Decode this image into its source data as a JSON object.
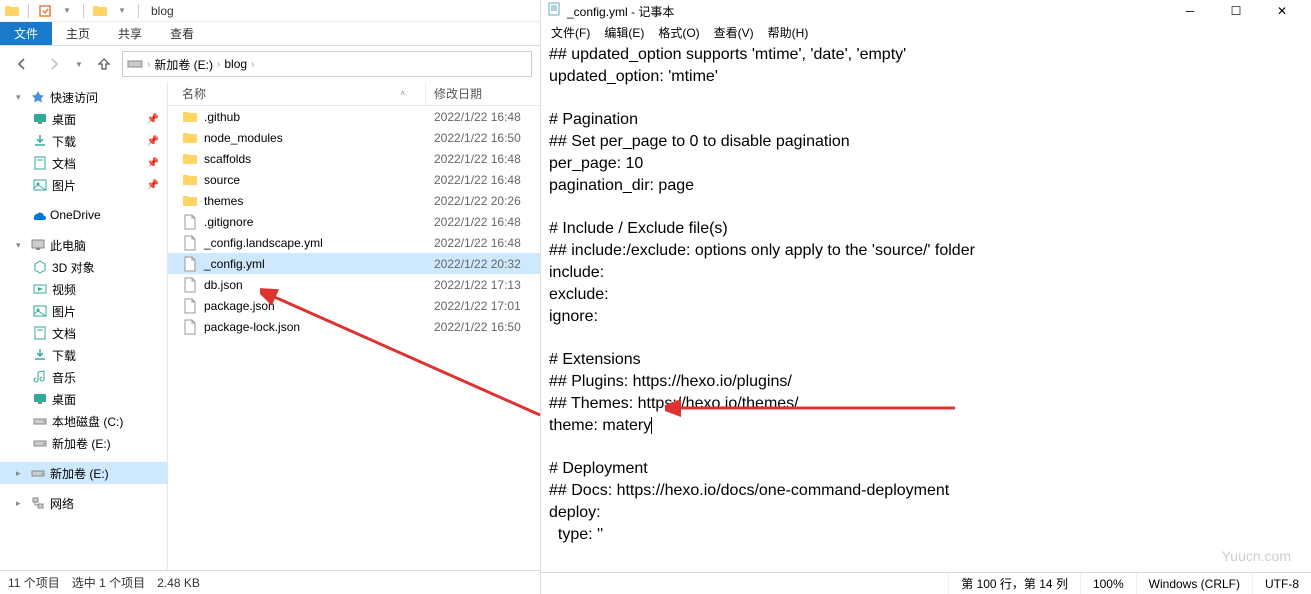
{
  "explorer": {
    "title": "blog",
    "ribbon": {
      "file": "文件",
      "tabs": [
        "主页",
        "共享",
        "查看"
      ]
    },
    "breadcrumb": {
      "items": [
        "新加卷 (E:)",
        "blog"
      ]
    },
    "nav": {
      "quick": {
        "label": "快速访问"
      },
      "items": [
        {
          "icon": "desktop",
          "label": "桌面",
          "pinned": true
        },
        {
          "icon": "download",
          "label": "下载",
          "pinned": true
        },
        {
          "icon": "document",
          "label": "文档",
          "pinned": true
        },
        {
          "icon": "picture",
          "label": "图片",
          "pinned": true
        }
      ],
      "onedrive": "OneDrive",
      "thispc": "此电脑",
      "pc_items": [
        {
          "icon": "3d",
          "label": "3D 对象"
        },
        {
          "icon": "video",
          "label": "视频"
        },
        {
          "icon": "picture",
          "label": "图片"
        },
        {
          "icon": "document",
          "label": "文档"
        },
        {
          "icon": "download",
          "label": "下载"
        },
        {
          "icon": "music",
          "label": "音乐"
        },
        {
          "icon": "desktop",
          "label": "桌面"
        },
        {
          "icon": "disk",
          "label": "本地磁盘 (C:)"
        },
        {
          "icon": "disk",
          "label": "新加卷 (E:)"
        }
      ],
      "drive_sel": "新加卷 (E:)",
      "network": "网络"
    },
    "columns": {
      "name": "名称",
      "date": "修改日期"
    },
    "files": [
      {
        "type": "folder",
        "name": ".github",
        "date": "2022/1/22 16:48"
      },
      {
        "type": "folder",
        "name": "node_modules",
        "date": "2022/1/22 16:50"
      },
      {
        "type": "folder",
        "name": "scaffolds",
        "date": "2022/1/22 16:48"
      },
      {
        "type": "folder",
        "name": "source",
        "date": "2022/1/22 16:48"
      },
      {
        "type": "folder",
        "name": "themes",
        "date": "2022/1/22 20:26"
      },
      {
        "type": "file",
        "name": ".gitignore",
        "date": "2022/1/22 16:48"
      },
      {
        "type": "file",
        "name": "_config.landscape.yml",
        "date": "2022/1/22 16:48"
      },
      {
        "type": "file",
        "name": "_config.yml",
        "date": "2022/1/22 20:32",
        "selected": true
      },
      {
        "type": "file",
        "name": "db.json",
        "date": "2022/1/22 17:13"
      },
      {
        "type": "file",
        "name": "package.json",
        "date": "2022/1/22 17:01"
      },
      {
        "type": "file",
        "name": "package-lock.json",
        "date": "2022/1/22 16:50"
      }
    ],
    "status": {
      "count": "11 个项目",
      "selected": "选中 1 个项目",
      "size": "2.48 KB"
    }
  },
  "notepad": {
    "title": "_config.yml - 记事本",
    "menu": [
      "文件(F)",
      "编辑(E)",
      "格式(O)",
      "查看(V)",
      "帮助(H)"
    ],
    "content": "## updated_option supports 'mtime', 'date', 'empty'\nupdated_option: 'mtime'\n\n# Pagination\n## Set per_page to 0 to disable pagination\nper_page: 10\npagination_dir: page\n\n# Include / Exclude file(s)\n## include:/exclude: options only apply to the 'source/' folder\ninclude:\nexclude:\nignore:\n\n# Extensions\n## Plugins: https://hexo.io/plugins/\n## Themes: https://hexo.io/themes/\ntheme: matery",
    "content2": "\n\n# Deployment\n## Docs: https://hexo.io/docs/one-command-deployment\ndeploy:\n  type: ''",
    "status": {
      "pos": "第 100 行，第 14 列",
      "zoom": "100%",
      "eol": "Windows (CRLF)",
      "enc": "UTF-8"
    }
  },
  "watermark": "Yuucn.com"
}
